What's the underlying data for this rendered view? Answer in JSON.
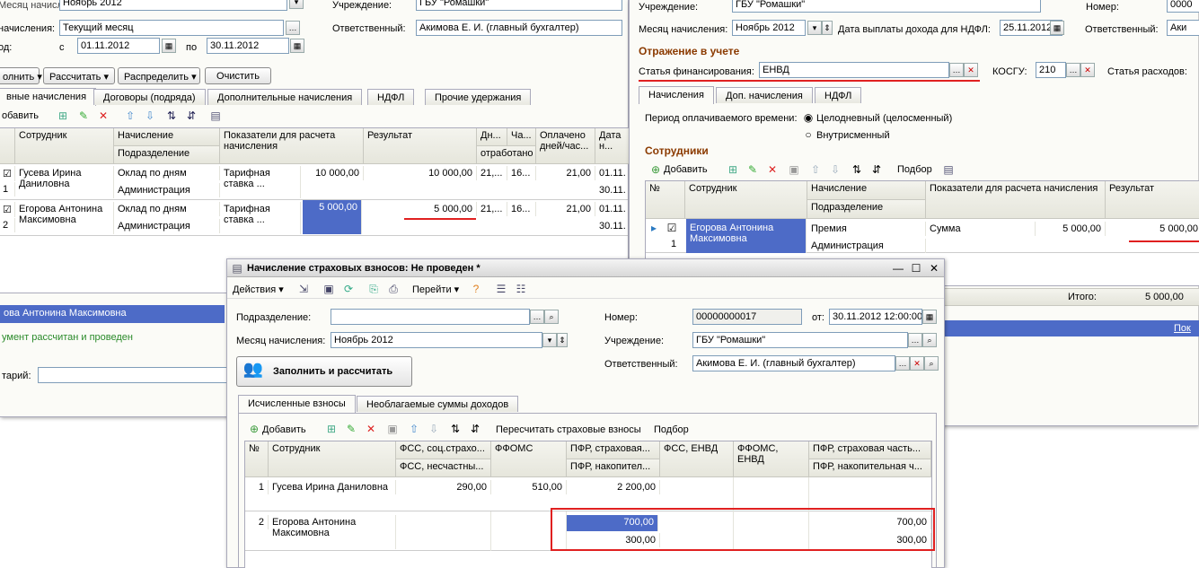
{
  "left_window": {
    "month_label": "Месяц начисления:",
    "month_value": "Ноябрь 2012",
    "institution_label": "Учреждение:",
    "institution_value": "ГБУ \"Ромашки\"",
    "accrual_label": "начисления:",
    "accrual_value": "Текущий месяц",
    "responsible_label": "Ответственный:",
    "responsible_value": "Акимова Е. И. (главный бухгалтер)",
    "period_label": "од:",
    "from_label": "с",
    "from_value": "01.11.2012",
    "to_label": "по",
    "to_value": "30.11.2012",
    "buttons": [
      "олнить",
      "Рассчитать",
      "Распределить",
      "Очистить"
    ],
    "tabs": [
      "вные начисления",
      "Договоры (подряда)",
      "Дополнительные начисления",
      "НДФЛ",
      "Прочие удержания"
    ],
    "add_label": "обавить",
    "headers": {
      "employee": "Сотрудник",
      "accrual": "Начисление",
      "department": "Подразделение",
      "indicators": "Показатели для расчета начисления",
      "result": "Результат",
      "days": "Дн...",
      "days2": "отработано",
      "hours": "Ча...",
      "paid": "Оплачено дней/час...",
      "date": "Дата н..."
    },
    "rows": [
      {
        "n": "1",
        "employee": "Гусева Ирина Даниловна",
        "accrual": "Оклад по дням",
        "department": "Администрация",
        "indicator": "Тарифная ставка ...",
        "indicator_value": "10 000,00",
        "result": "10 000,00",
        "days": "21,...",
        "hours": "16...",
        "paid": "21,00",
        "date1": "01.11.",
        "date2": "30.11."
      },
      {
        "n": "2",
        "employee": "Егорова Антонина Максимовна",
        "accrual": "Оклад по дням",
        "department": "Администрация",
        "indicator": "Тарифная ставка ...",
        "indicator_value": "5 000,00",
        "result": "5 000,00",
        "days": "21,...",
        "hours": "16...",
        "paid": "21,00",
        "date1": "01.11.",
        "date2": "30.11."
      }
    ],
    "status_name": "ова Антонина Максимовна",
    "status_msg": "умент рассчитан и проведен",
    "comment_label": "тарий:"
  },
  "right_window": {
    "institution_label": "Учреждение:",
    "institution_value": "ГБУ \"Ромашки\"",
    "number_label": "Номер:",
    "number_value": "0000",
    "month_label": "Месяц начисления:",
    "month_value": "Ноябрь 2012",
    "ndfl_label": "Дата выплаты дохода для НДФЛ:",
    "ndfl_value": "25.11.2012",
    "responsible_label": "Ответственный:",
    "responsible_value": "Аки",
    "section_title": "Отражение в учете",
    "fin_label": "Статья финансирования:",
    "fin_value": "ЕНВД",
    "kosgu_label": "КОСГУ:",
    "kosgu_value": "210",
    "expense_label": "Статья расходов:",
    "tabs": [
      "Начисления",
      "Доп. начисления",
      "НДФЛ"
    ],
    "period_label": "Период оплачиваемого времени:",
    "radio1": "Целодневный (целосменный)",
    "radio2": "Внутрисменный",
    "employees_title": "Сотрудники",
    "add_label": "Добавить",
    "select_label": "Подбор",
    "headers": {
      "n": "№",
      "employee": "Сотрудник",
      "accrual": "Начисление",
      "department": "Подразделение",
      "indicators": "Показатели для расчета начисления",
      "result": "Результат"
    },
    "row": {
      "n": "1",
      "employee": "Егорова Антонина Максимовна",
      "accrual": "Премия",
      "department": "Администрация",
      "indicator": "Сумма",
      "indicator_value": "5 000,00",
      "result": "5 000,00"
    },
    "total_label": "Итого:",
    "total_value": "5 000,00",
    "link": "Пок"
  },
  "front_window": {
    "title": "Начисление страховых взносов: Не проведен *",
    "toolbar": {
      "actions": "Действия",
      "goto": "Перейти"
    },
    "dept_label": "Подразделение:",
    "dept_value": "",
    "number_label": "Номер:",
    "number_value": "00000000017",
    "date_label": "от:",
    "date_value": "30.11.2012 12:00:00",
    "month_label": "Месяц начисления:",
    "month_value": "Ноябрь 2012",
    "institution_label": "Учреждение:",
    "institution_value": "ГБУ \"Ромашки\"",
    "responsible_label": "Ответственный:",
    "responsible_value": "Акимова Е. И. (главный бухгалтер)",
    "fill_button": "Заполнить и рассчитать",
    "tabs": [
      "Исчисленные взносы",
      "Необлагаемые суммы доходов"
    ],
    "add_label": "Добавить",
    "recalc_label": "Пересчитать страховые взносы",
    "select_label": "Подбор",
    "headers": {
      "n": "№",
      "employee": "Сотрудник",
      "fss1": "ФСС, соц.страхо...",
      "fss2": "ФСС, несчастны...",
      "ffoms": "ФФОМС",
      "pfr1": "ПФР, страховая...",
      "pfr2": "ПФР, накопител...",
      "fss_envd": "ФСС, ЕНВД",
      "ffoms_envd": "ФФОМС, ЕНВД",
      "pfr3": "ПФР, страховая часть...",
      "pfr4": "ПФР, накопительная ч..."
    },
    "rows": [
      {
        "n": "1",
        "employee": "Гусева Ирина Даниловна",
        "fss": "290,00",
        "ffoms": "510,00",
        "pfr1": "2 200,00",
        "pfr2": "",
        "pfr3": "",
        "pfr4": ""
      },
      {
        "n": "2",
        "employee": "Егорова Антонина Максимовна",
        "fss": "",
        "ffoms": "",
        "pfr1": "700,00",
        "pfr2": "300,00",
        "pfr3": "700,00",
        "pfr4": "300,00"
      }
    ]
  }
}
